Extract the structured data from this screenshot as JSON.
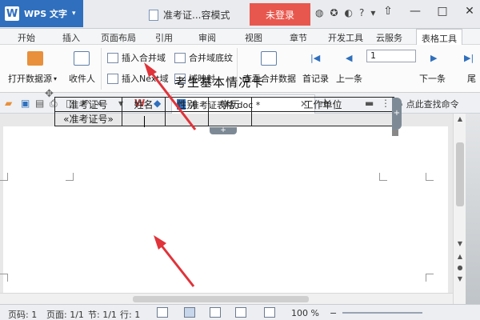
{
  "app": {
    "name": "WPS 文字",
    "logo_letter": "W",
    "menu_arrow": "▾"
  },
  "document": {
    "window_title": "准考证...容模式",
    "tab_title": "准考证表格.doc *"
  },
  "titlebar": {
    "login_label": "未登录",
    "icons": [
      "skin-icon",
      "share-icon",
      "feedback-icon",
      "help-icon",
      "minimize-ribbon-icon"
    ],
    "controls": [
      "—",
      "□",
      "✕"
    ]
  },
  "menu_tabs": [
    "开始",
    "插入",
    "页面布局",
    "引用",
    "审阅",
    "视图",
    "章节",
    "开发工具",
    "云服务",
    "表格工具"
  ],
  "active_tab": "表格工具",
  "ribbon": {
    "open_datasource": "打开数据源",
    "recipients": "收件人",
    "insert_merge_field": "插入合并域",
    "merge_field_shading": "合并域底纹",
    "insert_next_field": "插入Next域",
    "field_mapping": "域映射",
    "view_merged_data": "查看合并数据",
    "first_record": "首记录",
    "prev_record": "上一条",
    "record_value": "1",
    "next_record": "下一条",
    "last_record": "尾"
  },
  "quickbar": {
    "search_commands": "点此查找命令",
    "new_tab": "+"
  },
  "content": {
    "card_title": "考生基本情况卡",
    "headers": [
      "准考证号",
      "姓名",
      "性别",
      "学历",
      "工作单位"
    ],
    "row1": [
      "«准考证号»",
      "",
      "",
      "",
      ""
    ],
    "row_add": "+",
    "col_add": "+"
  },
  "status": {
    "page_no": "页码: 1",
    "pages": "页面: 1/1",
    "section": "节: 1/1",
    "row": "行: 1",
    "zoom": "100 %"
  },
  "colors": {
    "brand": "#2f6fbd",
    "login": "#e8574d",
    "arrow": "#e0333a"
  }
}
